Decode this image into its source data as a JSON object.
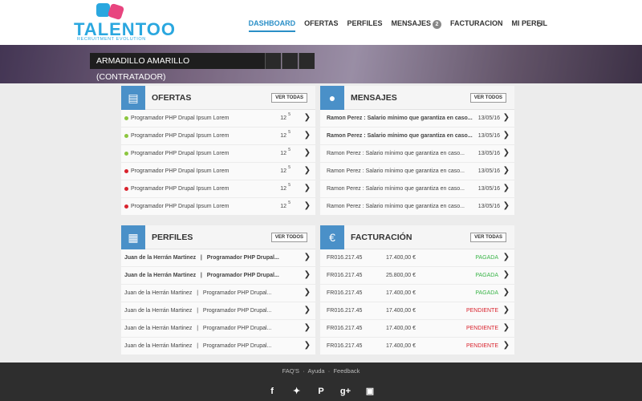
{
  "header": {
    "logo": {
      "word": "TALENTOO",
      "tagline": "RECRUITMENT EVOLUTION"
    },
    "nav": [
      {
        "label": "DASHBOARD",
        "active": true
      },
      {
        "label": "OFERTAS"
      },
      {
        "label": "PERFILES"
      },
      {
        "label": "MENSAJES",
        "badge": "2"
      },
      {
        "label": "FACTURACION"
      },
      {
        "label": "MI PERFIL"
      }
    ],
    "logout_icon": "logout-icon"
  },
  "hero": {
    "label": "ARMADILLO AMARILLO (CONTRATADOR)"
  },
  "panels": {
    "ofertas": {
      "title": "OFERTAS",
      "button": "VER TODAS",
      "icon": "newspaper-icon",
      "rows": [
        {
          "text": "Programador PHP Drupal Ipsum Lorem",
          "count": "12",
          "sup": "5",
          "status": "green"
        },
        {
          "text": "Programador PHP Drupal Ipsum Lorem",
          "count": "12",
          "sup": "5",
          "status": "green"
        },
        {
          "text": "Programador PHP Drupal Ipsum Lorem",
          "count": "12",
          "sup": "5",
          "status": "green"
        },
        {
          "text": "Programador PHP Drupal Ipsum Lorem",
          "count": "12",
          "sup": "5",
          "status": "red"
        },
        {
          "text": "Programador PHP Drupal Ipsum Lorem",
          "count": "12",
          "sup": "5",
          "status": "red"
        },
        {
          "text": "Programador PHP Drupal Ipsum Lorem",
          "count": "12",
          "sup": "5",
          "status": "red"
        }
      ]
    },
    "mensajes": {
      "title": "MENSAJES",
      "button": "VER TODOS",
      "icon": "chat-bubble-icon",
      "rows": [
        {
          "text": "Ramon Perez : Salario mínimo que garantiza en caso...",
          "date": "13/05/16",
          "unread": true
        },
        {
          "text": "Ramon Perez : Salario mínimo que garantiza en caso...",
          "date": "13/05/16",
          "unread": true
        },
        {
          "text": "Ramon Perez : Salario mínimo que garantiza en caso...",
          "date": "13/05/16",
          "unread": false
        },
        {
          "text": "Ramon Perez : Salario mínimo que garantiza en caso...",
          "date": "13/05/16",
          "unread": false
        },
        {
          "text": "Ramon Perez : Salario mínimo que garantiza en caso...",
          "date": "13/05/16",
          "unread": false
        },
        {
          "text": "Ramon Perez : Salario mínimo que garantiza en caso...",
          "date": "13/05/16",
          "unread": false
        }
      ]
    },
    "perfiles": {
      "title": "PERFILES",
      "button": "VER TODOS",
      "icon": "briefcase-icon",
      "rows": [
        {
          "text": "Juan de la Herrán Martinez   |   Programador PHP Drupal...",
          "bold": true
        },
        {
          "text": "Juan de la Herrán Martinez   |   Programador PHP Drupal...",
          "bold": true
        },
        {
          "text": "Juan de la Herrán Martinez   |   Programador PHP Drupal...",
          "bold": false
        },
        {
          "text": "Juan de la Herrán Martinez   |   Programador PHP Drupal...",
          "bold": false
        },
        {
          "text": "Juan de la Herrán Martinez   |   Programador PHP Drupal...",
          "bold": false
        },
        {
          "text": "Juan de la Herrán Martinez   |   Programador PHP Drupal...",
          "bold": false
        }
      ]
    },
    "facturacion": {
      "title": "FACTURACIÓN",
      "button": "VER TODAS",
      "icon": "euro-icon",
      "rows": [
        {
          "invoice": "FR016.217.45",
          "amount": "17.400,00 €",
          "status": "PAGADA"
        },
        {
          "invoice": "FR016.217.45",
          "amount": "25.800,00 €",
          "status": "PAGADA"
        },
        {
          "invoice": "FR016.217.45",
          "amount": "17.400,00 €",
          "status": "PAGADA"
        },
        {
          "invoice": "FR016.217.45",
          "amount": "17.400,00 €",
          "status": "PENDIENTE"
        },
        {
          "invoice": "FR016.217.45",
          "amount": "17.400,00 €",
          "status": "PENDIENTE"
        },
        {
          "invoice": "FR016.217.45",
          "amount": "17.400,00 €",
          "status": "PENDIENTE"
        }
      ]
    }
  },
  "footer": {
    "links": [
      "FAQ'S",
      "Ayuda",
      "Feedback"
    ],
    "social": [
      "facebook-icon",
      "twitter-icon",
      "pinterest-icon",
      "google-plus-icon",
      "instagram-icon"
    ]
  },
  "colors": {
    "accent": "#4a90c8",
    "paid": "#3cb54a",
    "pending": "#d9232d",
    "dot_green": "#8cc63f",
    "dot_red": "#d9232d"
  }
}
